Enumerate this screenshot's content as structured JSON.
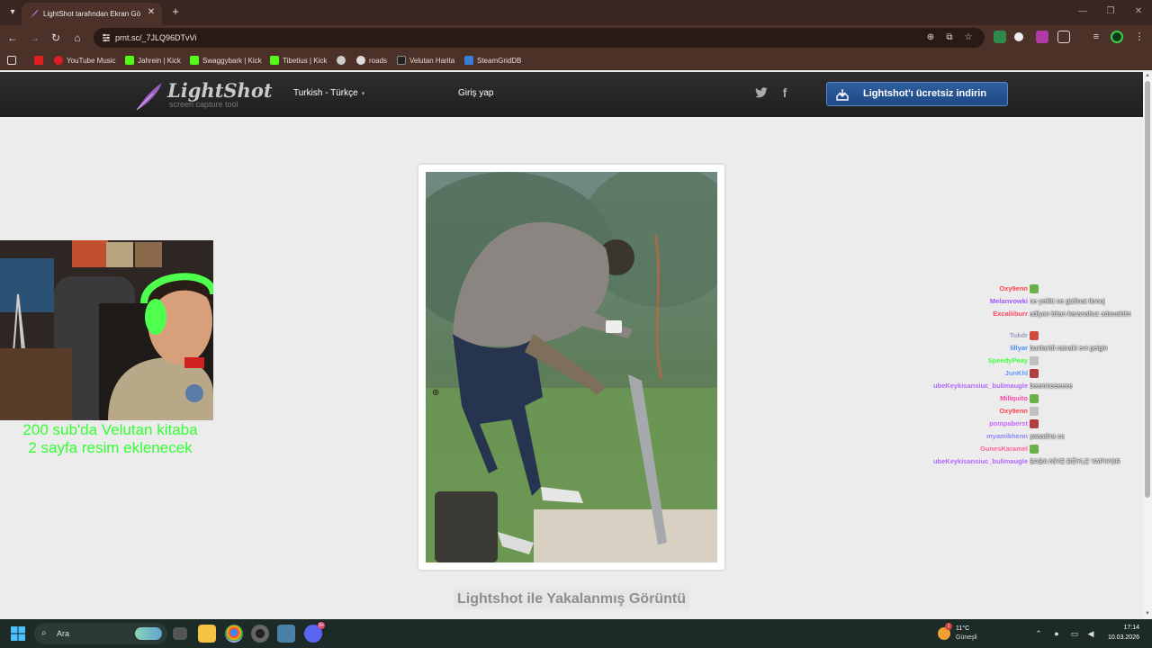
{
  "browser": {
    "tab_title": "LightShot tarafından Ekran Görüntüsü",
    "url": "prnt.sc/_7JLQ96DTvVi",
    "bookmarks": [
      {
        "label": "",
        "icon": "youtube-icon"
      },
      {
        "label": "YouTube Music",
        "icon": "youtube-music-icon"
      },
      {
        "label": "Jahrein | Kick",
        "icon": "kick-icon"
      },
      {
        "label": "Swaggybark | Kick",
        "icon": "kick-icon"
      },
      {
        "label": "Tibetius | Kick",
        "icon": "kick-icon"
      },
      {
        "label": "",
        "icon": "globe-icon"
      },
      {
        "label": "roads",
        "icon": "roads-icon"
      },
      {
        "label": "Velutan Harita",
        "icon": "map-icon"
      },
      {
        "label": "SteamGridDB",
        "icon": "steamgriddb-icon"
      }
    ]
  },
  "lightshot": {
    "logo_name": "LightShot",
    "logo_tagline": "screen capture tool",
    "language": "Turkish - Türkçe",
    "login": "Giriş yap",
    "download_button": "Lightshot'ı ücretsiz indirin",
    "caption": "Lightshot ile Yakalanmış Görüntü"
  },
  "overlay": {
    "sub_goal_line1": "200 sub'da Velutan kitaba",
    "sub_goal_line2": "2 sayfa resim eklenecek"
  },
  "chat": [
    {
      "user": "",
      "message": "",
      "color": "#ffffff"
    },
    {
      "user": "Oxy9enn",
      "message": "",
      "color": "#ff4444"
    },
    {
      "user": "Melanvowki",
      "message": "ne yeilitt ne gizlinat tkrooj",
      "color": "#9b59ff"
    },
    {
      "user": "Excaliiburr",
      "message": "adiyan bitan karanaltuz adavaktim",
      "color": "#ff4466"
    },
    {
      "user": "Tukdr",
      "message": "",
      "color": "#9999cc"
    },
    {
      "user": "lillyar",
      "message": "bunlaridi ratnaki evi geigin",
      "color": "#4488ff"
    },
    {
      "user": "SpeedyPeay",
      "message": "",
      "color": "#44ff44"
    },
    {
      "user": "JunKhl",
      "message": "",
      "color": "#6699ff"
    },
    {
      "user": "ubeKeykisansiuc_bulimaugle",
      "message": "beenmeeeeee",
      "color": "#b266ff"
    },
    {
      "user": "Millquito",
      "message": "",
      "color": "#ff44aa"
    },
    {
      "user": "Oxy9enn",
      "message": "",
      "color": "#ff4444"
    },
    {
      "user": "pompaberst",
      "message": "",
      "color": "#cc66ff"
    },
    {
      "user": "myamikhenn",
      "message": "yaaadna ca",
      "color": "#8888ff"
    },
    {
      "user": "GunesKaramel",
      "message": "",
      "color": "#ff6699"
    },
    {
      "user": "ubeKeykisansiuc_bulimaugle",
      "message": "BABA NİYE BÖYLE YAPIYOR",
      "color": "#b266ff"
    }
  ],
  "taskbar": {
    "search_label": "Ara",
    "weather_temp": "11°C",
    "weather_desc": "Güneşli",
    "weather_badge": "1",
    "discord_badge": "9+",
    "time": "17:14",
    "date": "10.03.2026"
  },
  "colors": {
    "chrome_frame": "#3a2621",
    "chrome_toolbar": "#4b3128",
    "download_button": "#2f5e9e",
    "sub_text": "#33ff33"
  }
}
